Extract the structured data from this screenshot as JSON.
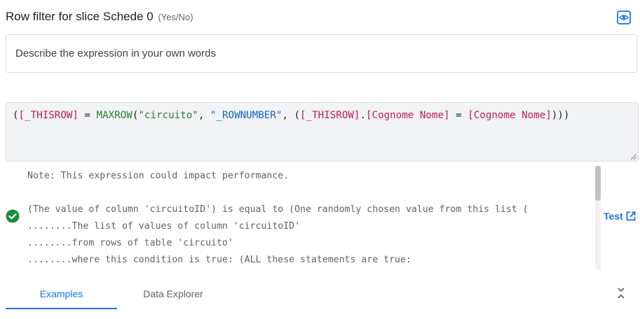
{
  "header": {
    "title": "Row filter for slice Schede 0",
    "type_suffix": "(Yes/No)",
    "preview_icon": "eye-icon"
  },
  "description": {
    "placeholder": "Describe the expression in your own words",
    "value": ""
  },
  "expression": {
    "tokens": [
      {
        "t": "(",
        "k": "op"
      },
      {
        "t": "[_THISROW]",
        "k": "col"
      },
      {
        "t": " = ",
        "k": "op"
      },
      {
        "t": "MAXROW",
        "k": "fn"
      },
      {
        "t": "(",
        "k": "op"
      },
      {
        "t": "\"circuito\"",
        "k": "fn"
      },
      {
        "t": ", ",
        "k": "op"
      },
      {
        "t": "\"_ROWNUMBER\"",
        "k": "str"
      },
      {
        "t": ", (",
        "k": "op"
      },
      {
        "t": "[_THISROW]",
        "k": "col"
      },
      {
        "t": ".",
        "k": "op"
      },
      {
        "t": "[Cognome Nome]",
        "k": "col"
      },
      {
        "t": " = ",
        "k": "op"
      },
      {
        "t": "[Cognome Nome]",
        "k": "col"
      },
      {
        "t": ")))",
        "k": "op"
      }
    ]
  },
  "result": {
    "note": "Note: This expression could impact performance.",
    "status_icon": "check-circle-icon",
    "lines": [
      "(The value of column 'circuitoID') is equal to (One randomly chosen value from this list (",
      "........The list of values of column 'circuitoID'",
      "........from rows of table 'circuito'",
      "........where this condition is true: (ALL these statements are true:"
    ],
    "test_label": "Test",
    "test_icon": "open-external-icon"
  },
  "tabs": [
    {
      "label": "Examples",
      "active": true
    },
    {
      "label": "Data Explorer",
      "active": false
    }
  ],
  "collapse_icon": "collapse-chevrons-icon",
  "colors": {
    "accent": "#1a73e8",
    "success": "#1e8e3e",
    "column_ref": "#c2185b",
    "function": "#2e7d32",
    "string": "#1565c0"
  }
}
